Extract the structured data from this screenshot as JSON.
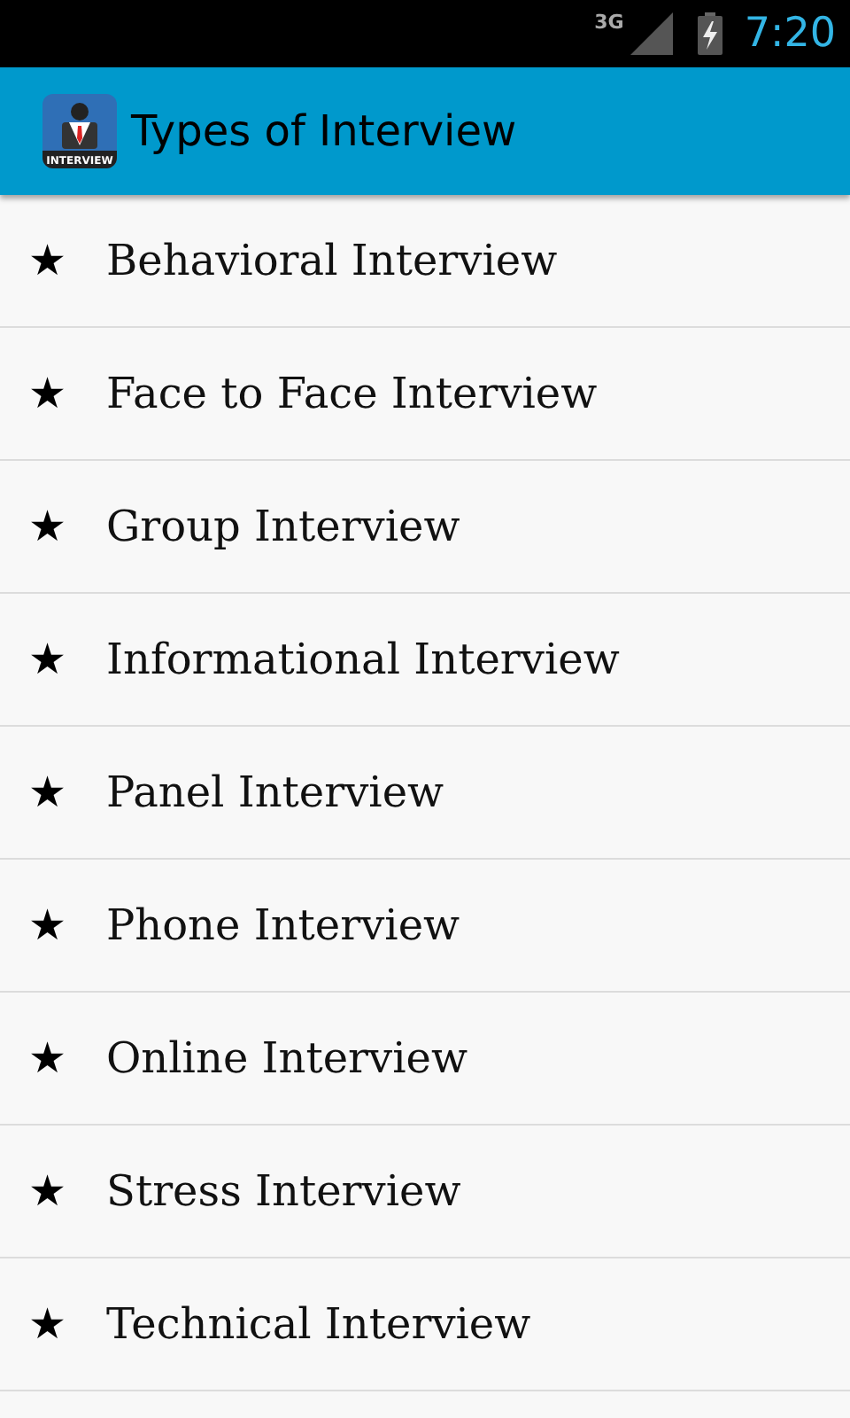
{
  "status_bar": {
    "network": "3G",
    "time": "7:20"
  },
  "action_bar": {
    "app_icon_label": "INTERVIEW",
    "title": "Types of Interview"
  },
  "items": [
    {
      "icon": "★",
      "label": "Behavioral Interview"
    },
    {
      "icon": "★",
      "label": "Face to Face Interview"
    },
    {
      "icon": "★",
      "label": "Group Interview"
    },
    {
      "icon": "★",
      "label": "Informational Interview"
    },
    {
      "icon": "★",
      "label": "Panel Interview"
    },
    {
      "icon": "★",
      "label": "Phone Interview"
    },
    {
      "icon": "★",
      "label": "Online Interview"
    },
    {
      "icon": "★",
      "label": "Stress Interview"
    },
    {
      "icon": "★",
      "label": "Technical Interview"
    }
  ]
}
